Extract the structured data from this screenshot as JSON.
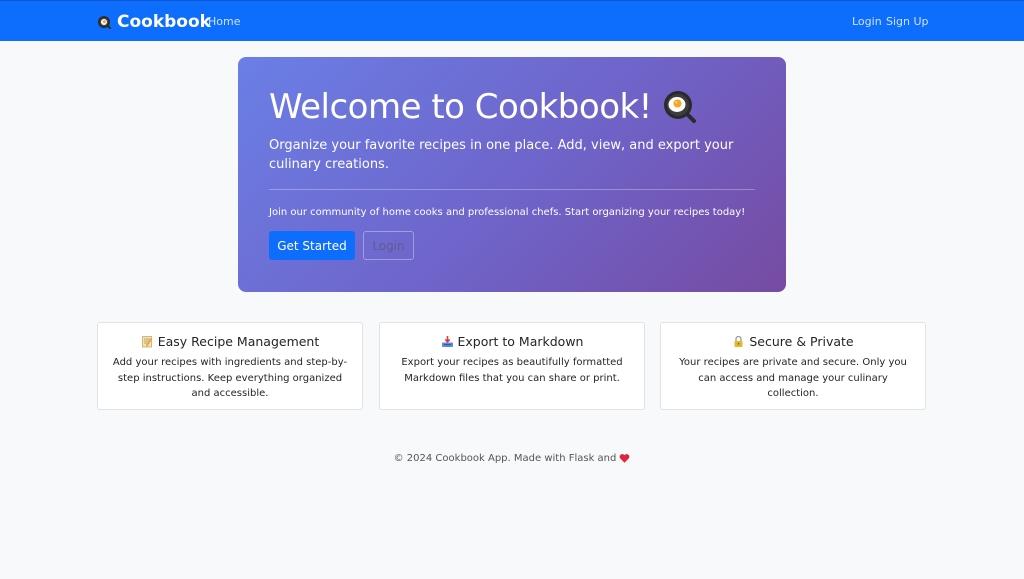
{
  "navbar": {
    "brand_icon": "frying-pan-icon",
    "brand": "Cookbook",
    "home": "Home",
    "login": "Login",
    "signup": "Sign Up",
    "color": "#0d6efd"
  },
  "hero": {
    "title": "Welcome to Cookbook!",
    "title_icon": "frying-pan-egg-icon",
    "lead": "Organize your favorite recipes in one place. Add, view, and export your culinary creations.",
    "join_text": "Join our community of home cooks and professional chefs. Start organizing your recipes today!",
    "get_started": "Get Started",
    "login": "Login",
    "gradient": [
      "#667eea",
      "#764ba2"
    ]
  },
  "features": [
    {
      "icon": "memo-icon",
      "title": "Easy Recipe Management",
      "text": "Add your recipes with ingredients and step-by-step instructions. Keep everything organized and accessible."
    },
    {
      "icon": "inbox-tray-icon",
      "title": "Export to Markdown",
      "text": "Export your recipes as beautifully formatted Markdown files that you can share or print."
    },
    {
      "icon": "lock-icon",
      "title": "Secure & Private",
      "text": "Your recipes are private and secure. Only you can access and manage your culinary collection."
    }
  ],
  "footer": {
    "text": "© 2024 Cookbook App. Made with Flask and",
    "icon": "red-heart-icon"
  }
}
